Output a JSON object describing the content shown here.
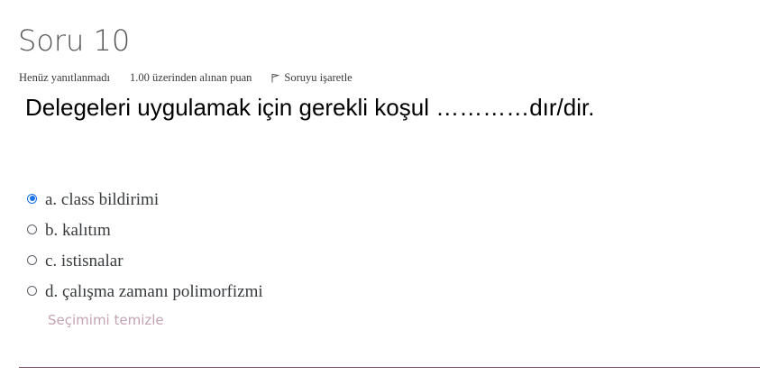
{
  "question": {
    "title": "Soru 10",
    "state": "Henüz yanıtlanmadı",
    "grade": "1.00 üzerinden alınan puan",
    "flag_label": "Soruyu işaretle",
    "text": "Delegeleri uygulamak için gerekli koşul …………dır/dir."
  },
  "answers": [
    {
      "label": "a. class bildirimi",
      "selected": true
    },
    {
      "label": "b. kalıtım",
      "selected": false
    },
    {
      "label": "c. istisnalar",
      "selected": false
    },
    {
      "label": "d. çalışma zamanı polimorfizmi",
      "selected": false
    }
  ],
  "clear_choice_label": "Seçimimi temizle",
  "colors": {
    "radio_selected": "#1a73e8",
    "clear_link": "#c4a3b3",
    "divider": "#7a4b63"
  },
  "icons": {
    "flag": "flag-icon"
  }
}
